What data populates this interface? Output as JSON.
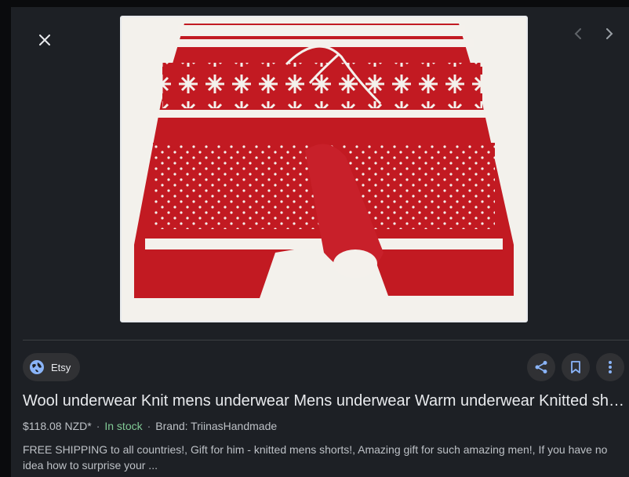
{
  "viewer": {
    "close_icon": "close-icon",
    "prev_icon": "chevron-left-icon",
    "next_icon": "chevron-right-icon",
    "image_alt": "Red and white knitted shorts"
  },
  "source": {
    "name": "Etsy",
    "icon": "globe-icon"
  },
  "actions": {
    "share_icon": "share-icon",
    "save_icon": "bookmark-icon",
    "more_icon": "more-vert-icon"
  },
  "product": {
    "title": "Wool underwear Knit mens underwear Mens underwear Warm underwear Knitted sho…",
    "price": "$118.08 NZD*",
    "stock": "In stock",
    "brand": "Brand: TriinasHandmade",
    "description": "FREE SHIPPING to all countries!, Gift for him - knitted mens shorts!, Amazing gift for such amazing men!, If you have no idea how to surprise your ..."
  },
  "colors": {
    "accent": "#8ab4f8",
    "in_stock": "#81c995",
    "panel": "#1d2025",
    "chip": "#303134"
  }
}
